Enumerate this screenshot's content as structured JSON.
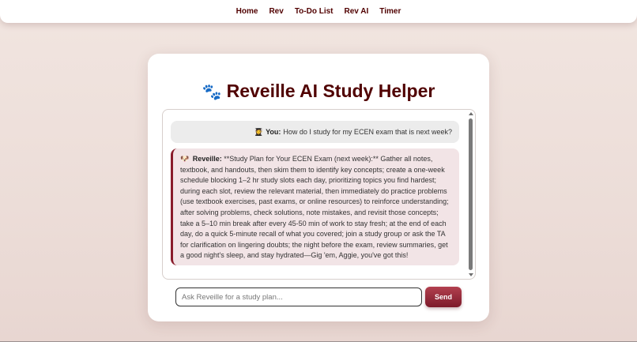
{
  "nav": {
    "items": [
      {
        "label": "Home"
      },
      {
        "label": "Rev"
      },
      {
        "label": "To-Do List"
      },
      {
        "label": "Rev AI"
      },
      {
        "label": "Timer"
      }
    ]
  },
  "page": {
    "title": "Reveille AI Study Helper",
    "title_icon": "🐾"
  },
  "chat": {
    "messages": [
      {
        "role": "user",
        "avatar_icon": "👩‍🎓",
        "sender": "You:",
        "text": "How do I study for my ECEN exam that is next week?"
      },
      {
        "role": "assistant",
        "avatar_icon": "🐶",
        "sender": "Reveille:",
        "text": "**Study Plan for Your ECEN Exam (next week):** Gather all notes, textbook, and handouts, then skim them to identify key concepts; create a one-week schedule blocking 1–2 hr study slots each day, prioritizing topics you find hardest; during each slot, review the relevant material, then immediately do practice problems (use textbook exercises, past exams, or online resources) to reinforce understanding; after solving problems, check solutions, note mistakes, and revisit those concepts; take a 5–10 min break after every 45-50 min of work to stay fresh; at the end of each day, do a quick 5-minute recall of what you covered; join a study group or ask the TA for clarification on lingering doubts; the night before the exam, review summaries, get a good night's sleep, and stay hydrated—Gig 'em, Aggie, you've got this!"
      }
    ]
  },
  "composer": {
    "placeholder": "Ask Reveille for a study plan...",
    "value": "",
    "send_label": "Send"
  },
  "colors": {
    "maroon": "#500000",
    "accent": "#8a1c2b",
    "button_top": "#b2404f",
    "button_bottom": "#7d1a2a"
  }
}
